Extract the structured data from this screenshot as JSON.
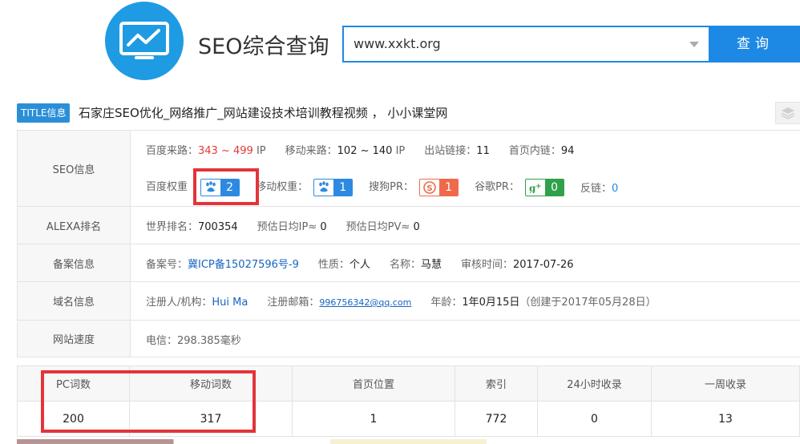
{
  "header": {
    "app_title": "SEO综合查询",
    "search_value": "www.xxkt.org",
    "search_button": "查询",
    "logo_icon": "chart-monitor-icon"
  },
  "title_row": {
    "tag": "TITLE信息",
    "text": "石家庄SEO优化_网络推广_网站建设技术培训教程视频 ， 小小课堂网"
  },
  "seo_info": {
    "label": "SEO信息",
    "baidu_traffic_label": "百度来路：",
    "baidu_traffic_value": "343 ~ 499",
    "baidu_traffic_unit": "IP",
    "mobile_traffic_label": "移动来路：",
    "mobile_traffic_value": "102 ~ 140",
    "mobile_traffic_unit": "IP",
    "outbound_label": "出站链接：",
    "outbound_value": "11",
    "internal_label": "首页内链：",
    "internal_value": "94",
    "baidu_weight_label": "百度权重",
    "baidu_weight_value": "2",
    "mobile_weight_label": "移动权重：",
    "mobile_weight_value": "1",
    "sogou_pr_label": "搜狗PR：",
    "sogou_pr_value": "1",
    "google_pr_label": "谷歌PR：",
    "google_pr_value": "0",
    "backlinks_label": "反链：",
    "backlinks_value": "0"
  },
  "alexa": {
    "label": "ALEXA排名",
    "world_rank_label": "世界排名：",
    "world_rank_value": "700354",
    "daily_ip_label": "预估日均IP≈",
    "daily_ip_value": "0",
    "daily_pv_label": "预估日均PV≈",
    "daily_pv_value": "0"
  },
  "icp": {
    "label": "备案信息",
    "number_label": "备案号：",
    "number_value": "冀ICP备15027596号-9",
    "nature_label": "性质：",
    "nature_value": "个人",
    "name_label": "名称：",
    "name_value": "马慧",
    "review_label": "审核时间：",
    "review_value": "2017-07-26"
  },
  "domain": {
    "label": "域名信息",
    "registrant_label": "注册人/机构：",
    "registrant_value": "Hui Ma",
    "email_label": "注册邮箱：",
    "email_value": "996756342@qq.com",
    "age_label": "年龄：",
    "age_value": "1年0月15日",
    "created_note": "（创建于2017年05月28日）"
  },
  "speed": {
    "label": "网站速度",
    "value": "电信：298.385毫秒"
  },
  "stats": {
    "headers": [
      "PC词数",
      "移动词数",
      "首页位置",
      "索引",
      "24小时收录",
      "一周收录"
    ],
    "values": [
      "200",
      "317",
      "1",
      "772",
      "0",
      "13"
    ]
  },
  "colors": {
    "accent": "#1e88e5",
    "highlight": "#e3343a",
    "traffic_red": "#e53935"
  }
}
